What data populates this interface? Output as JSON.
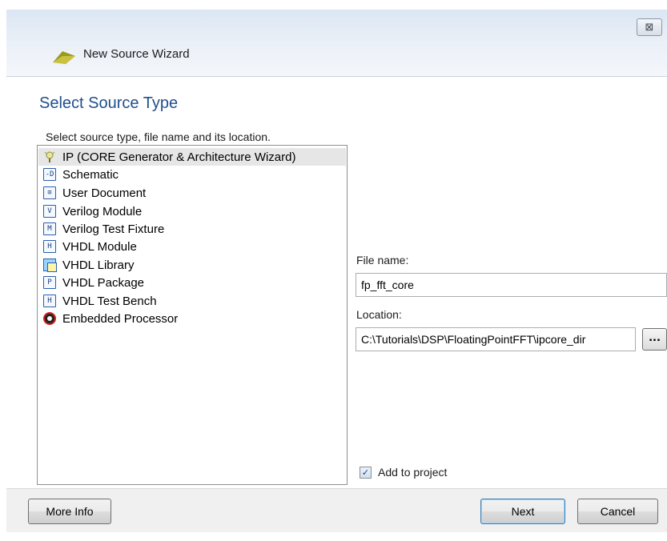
{
  "window": {
    "close_glyph": "⊠",
    "title": "New Source Wizard"
  },
  "page": {
    "title": "Select Source Type",
    "instructions": "Select source type, file name and its location."
  },
  "source_types": [
    {
      "label": "IP (CORE Generator & Architecture Wizard)",
      "icon": "ip-core-icon",
      "selected": true
    },
    {
      "label": "Schematic",
      "icon": "schematic-icon",
      "glyph": "-D"
    },
    {
      "label": "User Document",
      "icon": "document-icon",
      "glyph": "≡"
    },
    {
      "label": "Verilog Module",
      "icon": "verilog-module-icon",
      "glyph": "V"
    },
    {
      "label": "Verilog Test Fixture",
      "icon": "verilog-test-fixture-icon",
      "glyph": "M"
    },
    {
      "label": "VHDL Module",
      "icon": "vhdl-module-icon",
      "glyph": "H"
    },
    {
      "label": "VHDL Library",
      "icon": "vhdl-library-icon"
    },
    {
      "label": "VHDL Package",
      "icon": "vhdl-package-icon",
      "glyph": "P"
    },
    {
      "label": "VHDL Test Bench",
      "icon": "vhdl-test-bench-icon",
      "glyph": "H"
    },
    {
      "label": "Embedded Processor",
      "icon": "embedded-processor-icon"
    }
  ],
  "form": {
    "file_name_label": "File name:",
    "file_name_value": "fp_fft_core",
    "location_label": "Location:",
    "location_value": "C:\\Tutorials\\DSP\\FloatingPointFFT\\ipcore_dir",
    "browse_label": "...",
    "add_to_project_label": "Add to project",
    "add_to_project_checked": true
  },
  "buttons": {
    "more_info": "More Info",
    "next": "Next",
    "cancel": "Cancel"
  },
  "colors": {
    "heading": "#1f4f8b",
    "selection": "#e6e6e6",
    "titlebar": "#dbe6f3"
  }
}
